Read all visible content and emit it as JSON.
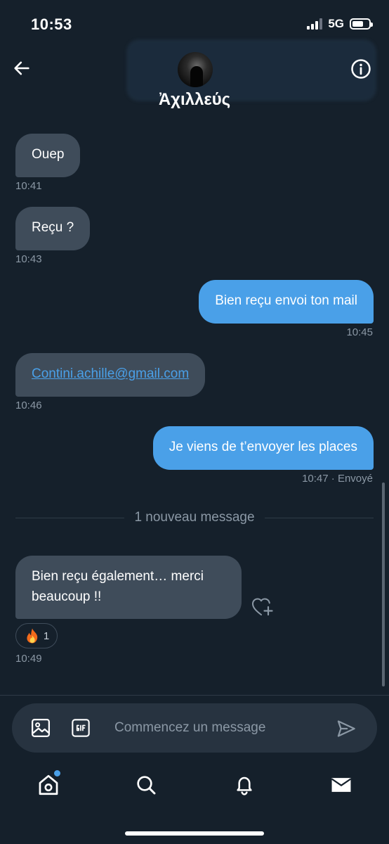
{
  "status_bar": {
    "time": "10:53",
    "network": "5G"
  },
  "header": {
    "contact_name": "Ἀχιλλεύς"
  },
  "messages": [
    {
      "text": "Ouep",
      "time": "10:41"
    },
    {
      "text": "Reçu ?",
      "time": "10:43"
    },
    {
      "text": "Bien reçu envoi ton mail",
      "time": "10:45"
    },
    {
      "text": "Contini.achille@gmail.com",
      "time": "10:46"
    },
    {
      "text": "Je viens de t’envoyer les places",
      "time": "10:47",
      "status": " · Envoyé"
    },
    {
      "text": "Bien reçu également… merci beaucoup !!",
      "time": "10:49",
      "reaction_count": "1"
    }
  ],
  "divider": {
    "label": "1 nouveau message"
  },
  "composer": {
    "placeholder": "Commencez un message"
  },
  "colors": {
    "background": "#15202b",
    "sent_bubble": "#4aa0e8",
    "received_bubble": "#3f4c5a",
    "muted_text": "#8b98a5"
  }
}
